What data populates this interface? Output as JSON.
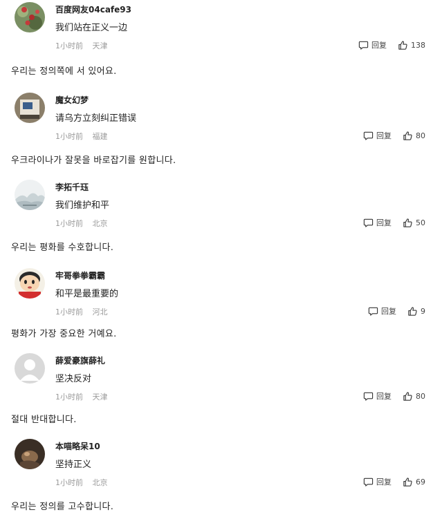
{
  "ui": {
    "reply_label": "回复"
  },
  "comments": [
    {
      "username": "百度网友04cafe93",
      "text": "我们站在正义一边",
      "time": "1小时前",
      "location": "天津",
      "likes": "138",
      "translation": "우리는 정의쪽에 서 있어요.",
      "avatar_icon": "avatar-berries-photo"
    },
    {
      "username": "魔女幻梦",
      "text": "请乌方立刻纠正错误",
      "time": "1小时前",
      "location": "福建",
      "likes": "80",
      "translation": "우크라이나가 잘못을 바로잡기를 원합니다.",
      "avatar_icon": "avatar-book-photo"
    },
    {
      "username": "李拓千珏",
      "text": "我们维护和平",
      "time": "1小时前",
      "location": "北京",
      "likes": "50",
      "translation": "우리는 평화를 수호합니다.",
      "avatar_icon": "avatar-ink-landscape"
    },
    {
      "username": "牢哥拳拳霸霸",
      "text": "和平是最重要的",
      "time": "1小时前",
      "location": "河北",
      "likes": "9",
      "translation": "평화가 가장 중요한 거예요.",
      "avatar_icon": "avatar-cartoon-boy"
    },
    {
      "username": "薛爱豪旗薛礼",
      "text": "坚决反对",
      "time": "1小时前",
      "location": "天津",
      "likes": "80",
      "translation": "절대 반대합니다.",
      "avatar_icon": "avatar-default-person"
    },
    {
      "username": "本喵略呆10",
      "text": "坚持正义",
      "time": "1小时前",
      "location": "北京",
      "likes": "69",
      "translation": "우리는 정의를 고수합니다.",
      "avatar_icon": "avatar-dark-photo"
    }
  ]
}
